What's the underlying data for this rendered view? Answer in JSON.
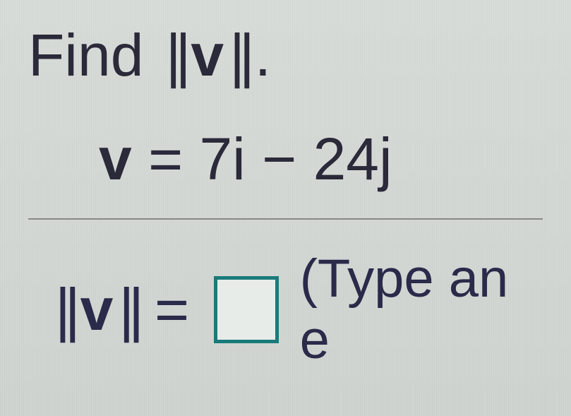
{
  "problem": {
    "prompt_prefix": "Find ",
    "prompt_vector": "v",
    "prompt_suffix": ".",
    "vector_definition": {
      "lhs": "v",
      "equals": "=",
      "rhs": "7i − 24j"
    },
    "answer_line": {
      "lhs_vector": "v",
      "equals": "=",
      "hint_prefix": "(Type an e"
    }
  },
  "answer_input": {
    "value": ""
  }
}
